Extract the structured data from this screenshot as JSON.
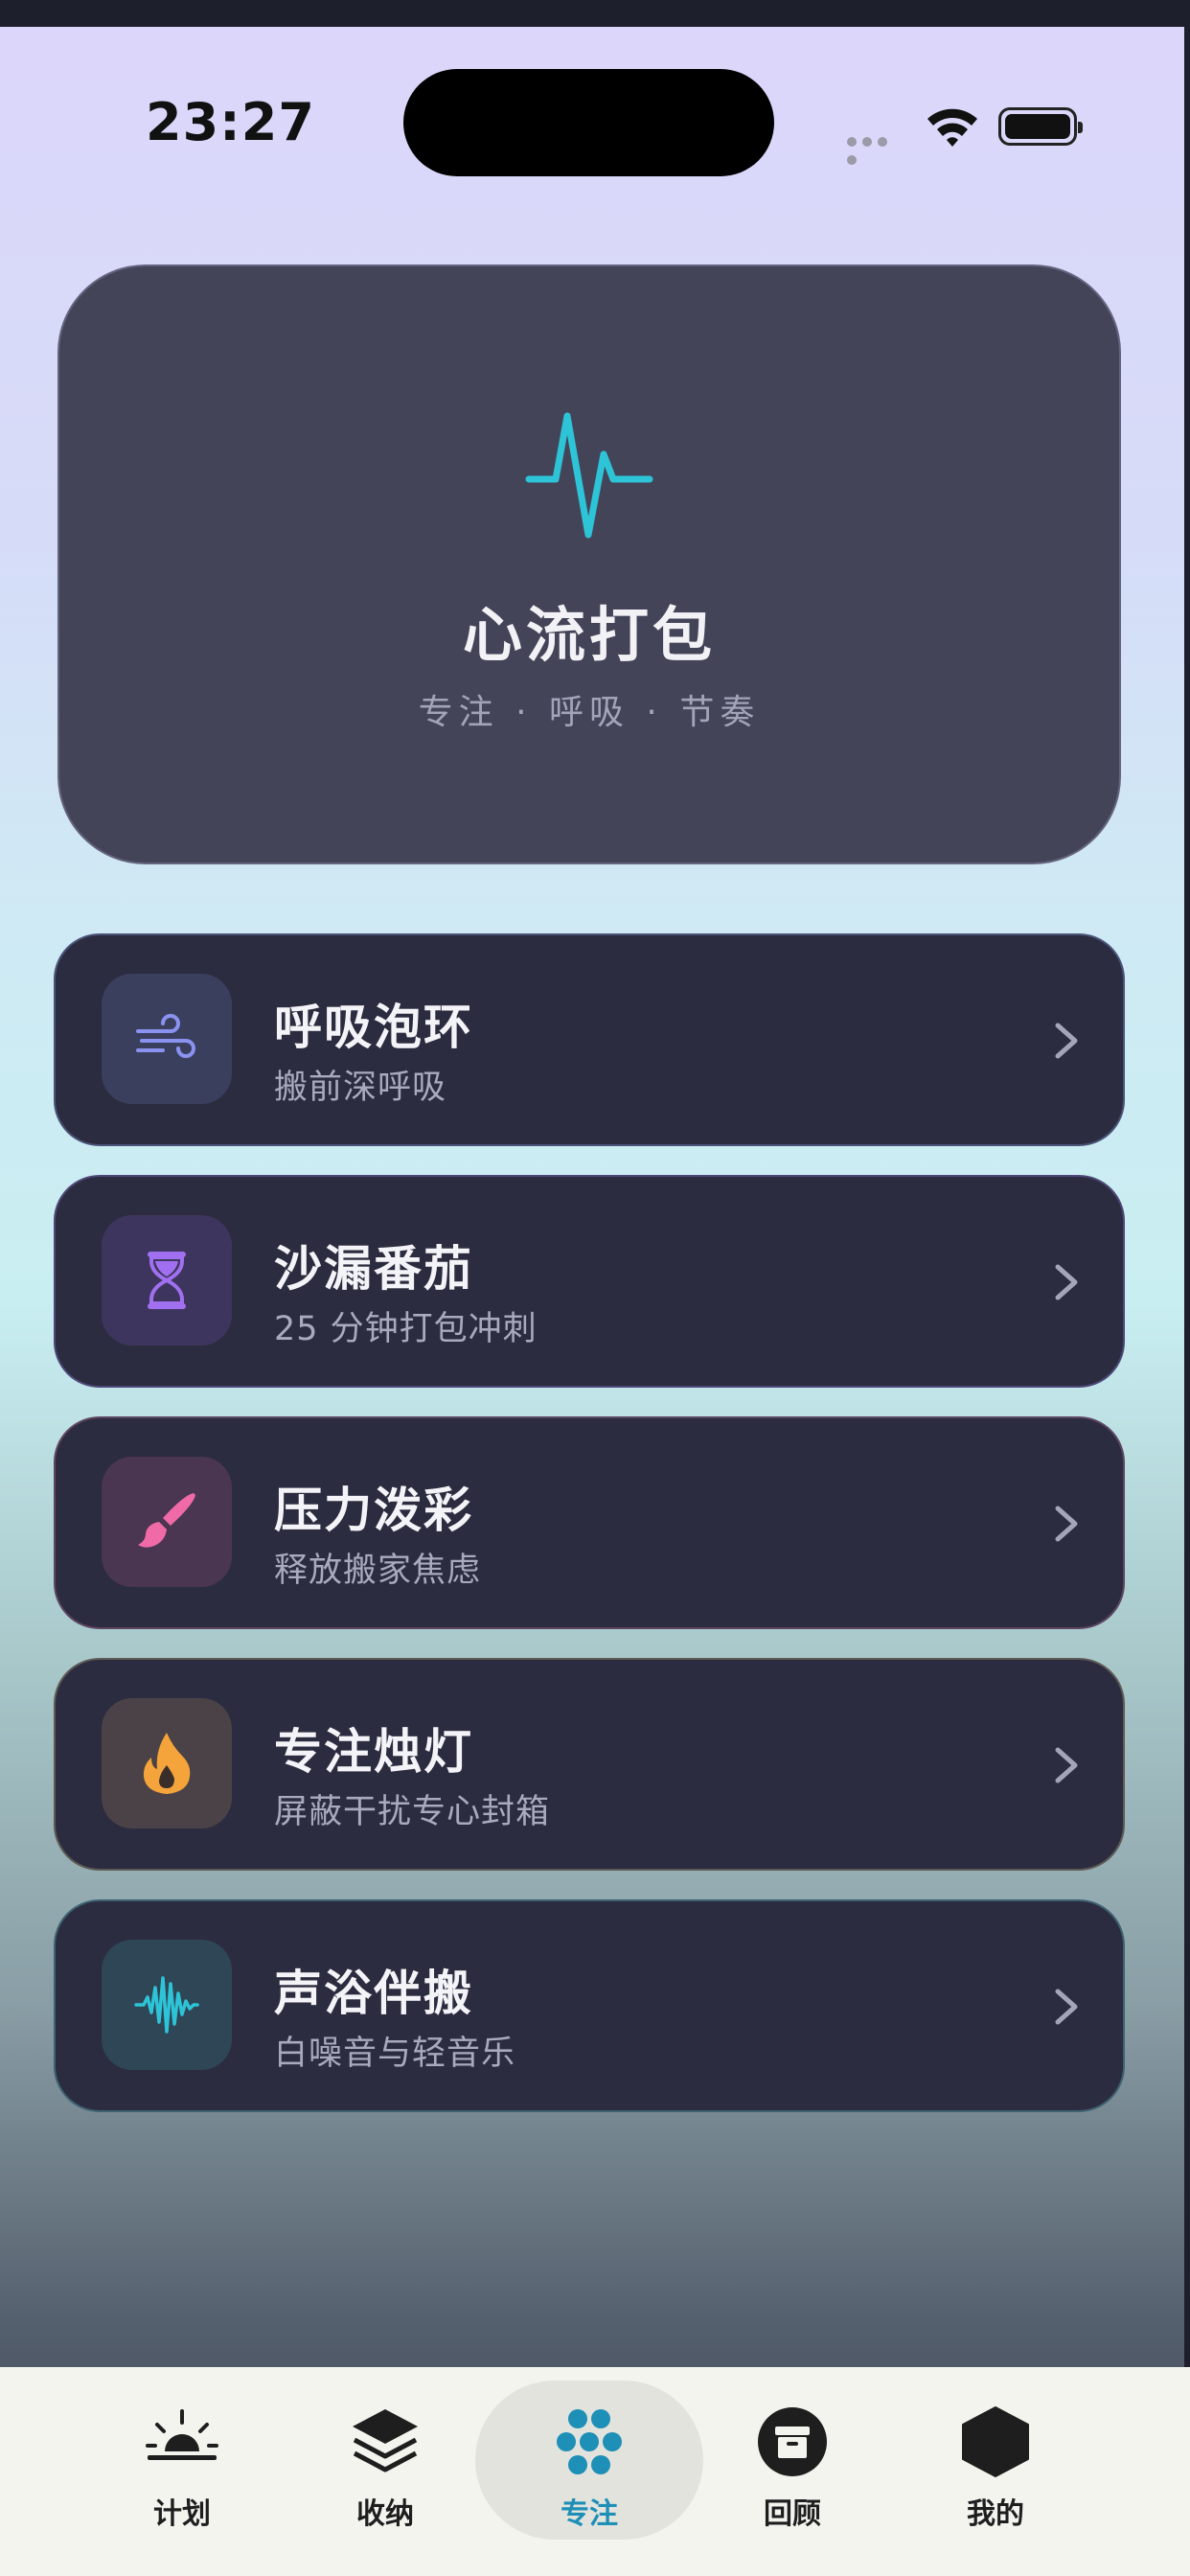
{
  "status_bar": {
    "time": "23:27"
  },
  "hero": {
    "title": "心流打包",
    "subtitle": "专注 · 呼吸 · 节奏"
  },
  "items": [
    {
      "name": "呼吸泡环",
      "desc": "搬前深呼吸",
      "icon": "wind-icon",
      "color": "#7c86e8"
    },
    {
      "name": "沙漏番茄",
      "desc": "25 分钟打包冲刺",
      "icon": "hourglass-icon",
      "color": "#a070f0"
    },
    {
      "name": "压力泼彩",
      "desc": "释放搬家焦虑",
      "icon": "paintbrush-icon",
      "color": "#f06aa8"
    },
    {
      "name": "专注烛灯",
      "desc": "屏蔽干扰专心封箱",
      "icon": "flame-icon",
      "color": "#f4a43a"
    },
    {
      "name": "声浴伴搬",
      "desc": "白噪音与轻音乐",
      "icon": "waveform-icon",
      "color": "#2ec4d8"
    }
  ],
  "tabs": [
    {
      "label": "计划",
      "icon": "sunrise-icon"
    },
    {
      "label": "收纳",
      "icon": "layers-icon"
    },
    {
      "label": "专注",
      "icon": "flower-icon",
      "active": true
    },
    {
      "label": "回顾",
      "icon": "archive-icon"
    },
    {
      "label": "我的",
      "icon": "hexagon-icon"
    }
  ],
  "colors": {
    "accent": "#1e8fb6",
    "pulse": "#2ec4d8",
    "card_bg": "#2b2c3f"
  }
}
